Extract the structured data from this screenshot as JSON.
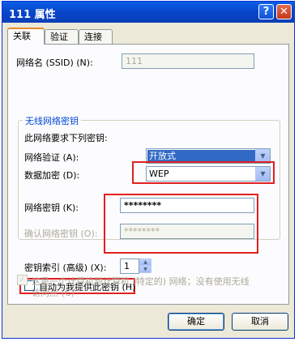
{
  "window": {
    "title": "111 属性",
    "help_glyph": "?",
    "close_glyph": "✕"
  },
  "tabs": [
    {
      "label": "关联"
    },
    {
      "label": "验证"
    },
    {
      "label": "连接"
    }
  ],
  "ssid": {
    "label": "网络名 (SSID) (N):",
    "value": "111"
  },
  "group": {
    "legend": "无线网络密钥",
    "intro": "此网络要求下列密钥:"
  },
  "auth": {
    "label": "网络验证 (A):",
    "value": "开放式"
  },
  "encryption": {
    "label": "数据加密 (D):",
    "value": "WEP"
  },
  "key": {
    "label": "网络密钥 (K):",
    "value": "********"
  },
  "confirm_key": {
    "label": "确认网络密钥 (O):",
    "value": "********"
  },
  "key_index": {
    "label": "密钥索引 (高级) (X):",
    "value": "1"
  },
  "auto_key": {
    "label": "自动为我提供此密钥 (H)",
    "checked": false
  },
  "adhoc": {
    "line1": "这是一个计算机到计算机 (特定的) 网络；没有使用无线",
    "line2": "访问点 (C)",
    "checked": true
  },
  "buttons": {
    "ok": "确定",
    "cancel": "取消"
  },
  "colors": {
    "titlebar": "#0845c9",
    "highlight_box": "#e02020",
    "selection": "#316ac5"
  }
}
